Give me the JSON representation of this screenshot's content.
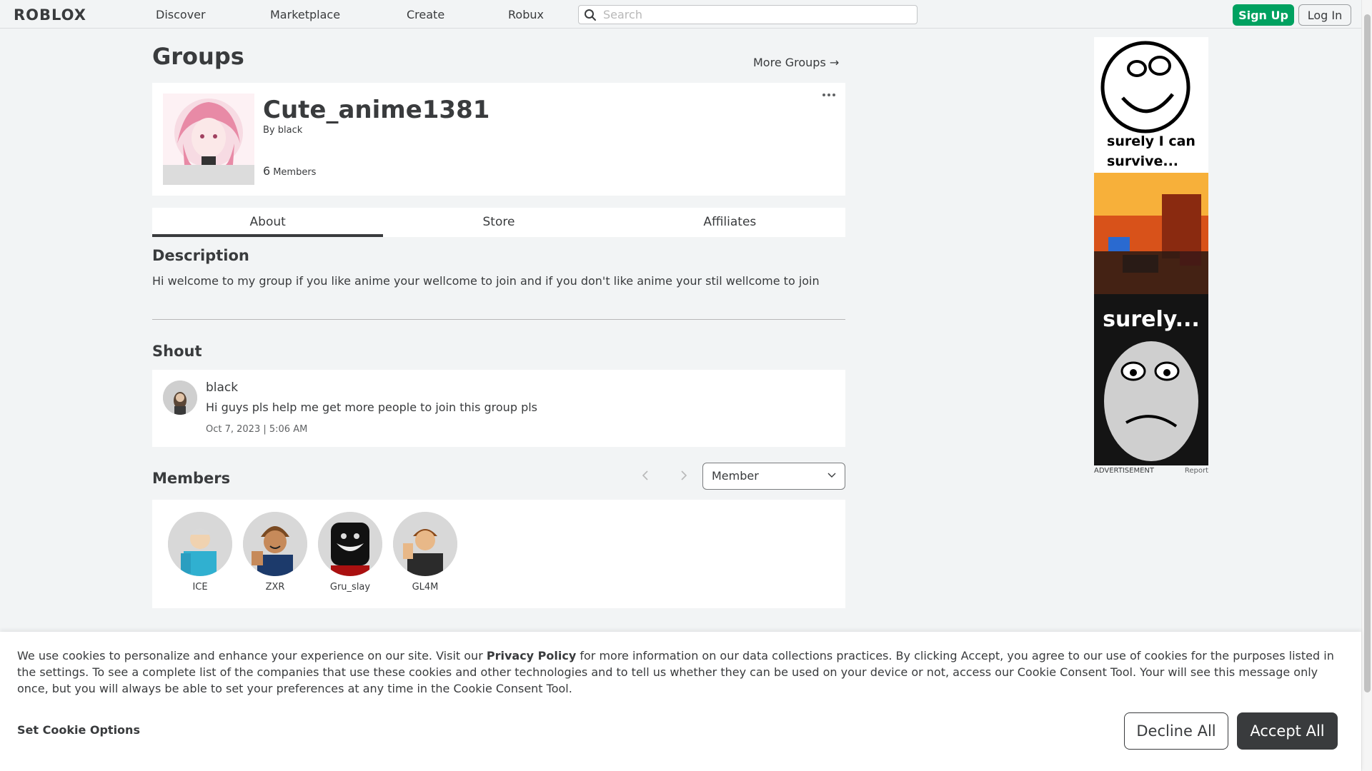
{
  "nav": {
    "logo": "ROBLOX",
    "links": [
      "Discover",
      "Marketplace",
      "Create",
      "Robux"
    ],
    "search_placeholder": "Search",
    "signup_label": "Sign Up",
    "login_label": "Log In"
  },
  "page": {
    "title": "Groups",
    "more_groups": "More Groups →"
  },
  "group": {
    "name": "Cute_anime1381",
    "by_label": "By",
    "owner": "black",
    "member_count": "6",
    "members_label": "Members"
  },
  "tabs": [
    "About",
    "Store",
    "Affiliates"
  ],
  "about": {
    "description_title": "Description",
    "description": "Hi welcome to my group if you like anime your wellcome to join and if you don't like anime your stil wellcome to join",
    "shout_title": "Shout",
    "shout": {
      "author": "black",
      "body": "Hi guys pls help me get more people to join this group pls",
      "date": "Oct 7, 2023 | 5:06 AM"
    },
    "members_title": "Members",
    "role_filter": "Member",
    "members": [
      {
        "name": "ICE",
        "color": "#30b0d0"
      },
      {
        "name": "ZXR",
        "color": "#1c3a6b"
      },
      {
        "name": "Gru_slay",
        "color": "#111111"
      },
      {
        "name": "GL4M",
        "color": "#2b2b2b"
      }
    ]
  },
  "ad": {
    "text_top": "surely I can survive...",
    "text_bottom": "surely...",
    "label": "ADVERTISEMENT",
    "report": "Report"
  },
  "cookie": {
    "text_before_link": "We use cookies to personalize and enhance your experience on our site. Visit our ",
    "link": "Privacy Policy",
    "text_after_link": " for more information on our data collections practices. By clicking Accept, you agree to our use of cookies for the purposes listed in the settings. To see a complete list of the companies that use these cookies and other technologies and to tell us whether they can be used on your device or not, access our Cookie Consent Tool. Your will see this message only once, but you will always be able to set your preferences at any time in the Cookie Consent Tool.",
    "set_options": "Set Cookie Options",
    "decline": "Decline All",
    "accept": "Accept All"
  },
  "colors": {
    "signup_green": "#00a160",
    "accept_dark": "#393b3d",
    "background": "#f2f4f5"
  }
}
